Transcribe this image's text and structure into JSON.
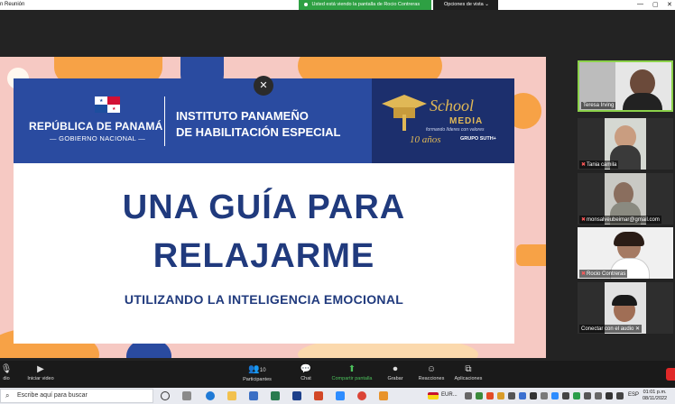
{
  "window": {
    "title": "n Reunión",
    "share_notice": "Usted está viendo la pantalla de Rocio Contreras",
    "view_options": "Opciones de vista",
    "controls": [
      "—",
      "▢",
      "✕"
    ]
  },
  "slide": {
    "republic": "REPÚBLICA DE PANAMÁ",
    "government": "— GOBIERNO NACIONAL —",
    "institute_line1": "INSTITUTO PANAMEÑO",
    "institute_line2": "DE HABILITACIÓN ESPECIAL",
    "school_word": "School",
    "media_word": "MEDIA",
    "tagline": "formando líderes con valores",
    "years": "10 años",
    "group": "GRUPO SUTH+",
    "title_line1": "UNA GUÍA PARA",
    "title_line2": "RELAJARME",
    "subtitle": "UTILIZANDO LA INTELIGENCIA EMOCIONAL",
    "close_glyph": "✕"
  },
  "participants": [
    {
      "name": "Teresa Irving",
      "muted": false
    },
    {
      "name": "Tania camila",
      "muted": true
    },
    {
      "name": "monsalveubeimar@gmail.com",
      "muted": true
    },
    {
      "name": "Rocio Contreras",
      "muted": true
    },
    {
      "name": "Conectar con el audio",
      "muted": false
    }
  ],
  "toolbar": {
    "audio_label": "dio",
    "video_label": "Iniciar video",
    "participants_label": "Participantes",
    "participants_count": "10",
    "chat_label": "Chat",
    "share_label": "Compartir pantalla",
    "record_label": "Grabar",
    "reactions_label": "Reacciones",
    "apps_label": "Aplicaciones",
    "end_label": "S"
  },
  "taskbar": {
    "search_placeholder": "Escribe aquí para buscar",
    "currency": "EUR...",
    "lang": "ESP",
    "time": "01:01 p.m.",
    "date": "08/11/2022"
  }
}
